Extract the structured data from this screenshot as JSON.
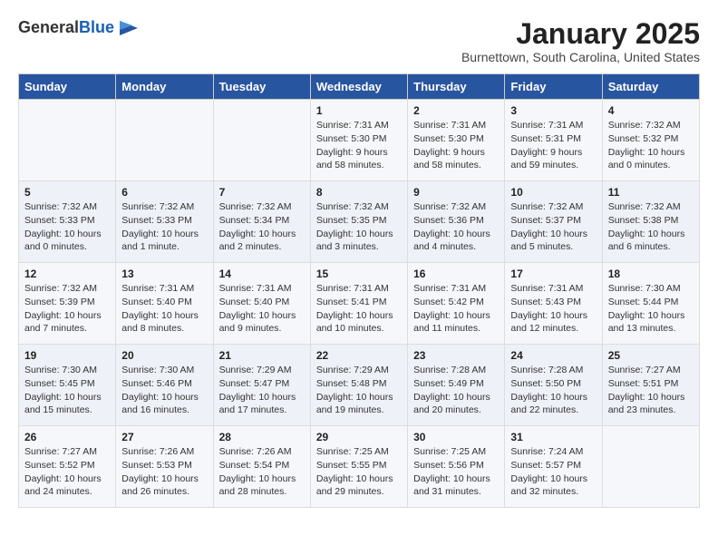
{
  "header": {
    "logo_general": "General",
    "logo_blue": "Blue",
    "month_title": "January 2025",
    "location": "Burnettown, South Carolina, United States"
  },
  "days_of_week": [
    "Sunday",
    "Monday",
    "Tuesday",
    "Wednesday",
    "Thursday",
    "Friday",
    "Saturday"
  ],
  "weeks": [
    [
      {
        "day": "",
        "info": ""
      },
      {
        "day": "",
        "info": ""
      },
      {
        "day": "",
        "info": ""
      },
      {
        "day": "1",
        "info": "Sunrise: 7:31 AM\nSunset: 5:30 PM\nDaylight: 9 hours\nand 58 minutes."
      },
      {
        "day": "2",
        "info": "Sunrise: 7:31 AM\nSunset: 5:30 PM\nDaylight: 9 hours\nand 58 minutes."
      },
      {
        "day": "3",
        "info": "Sunrise: 7:31 AM\nSunset: 5:31 PM\nDaylight: 9 hours\nand 59 minutes."
      },
      {
        "day": "4",
        "info": "Sunrise: 7:32 AM\nSunset: 5:32 PM\nDaylight: 10 hours\nand 0 minutes."
      }
    ],
    [
      {
        "day": "5",
        "info": "Sunrise: 7:32 AM\nSunset: 5:33 PM\nDaylight: 10 hours\nand 0 minutes."
      },
      {
        "day": "6",
        "info": "Sunrise: 7:32 AM\nSunset: 5:33 PM\nDaylight: 10 hours\nand 1 minute."
      },
      {
        "day": "7",
        "info": "Sunrise: 7:32 AM\nSunset: 5:34 PM\nDaylight: 10 hours\nand 2 minutes."
      },
      {
        "day": "8",
        "info": "Sunrise: 7:32 AM\nSunset: 5:35 PM\nDaylight: 10 hours\nand 3 minutes."
      },
      {
        "day": "9",
        "info": "Sunrise: 7:32 AM\nSunset: 5:36 PM\nDaylight: 10 hours\nand 4 minutes."
      },
      {
        "day": "10",
        "info": "Sunrise: 7:32 AM\nSunset: 5:37 PM\nDaylight: 10 hours\nand 5 minutes."
      },
      {
        "day": "11",
        "info": "Sunrise: 7:32 AM\nSunset: 5:38 PM\nDaylight: 10 hours\nand 6 minutes."
      }
    ],
    [
      {
        "day": "12",
        "info": "Sunrise: 7:32 AM\nSunset: 5:39 PM\nDaylight: 10 hours\nand 7 minutes."
      },
      {
        "day": "13",
        "info": "Sunrise: 7:31 AM\nSunset: 5:40 PM\nDaylight: 10 hours\nand 8 minutes."
      },
      {
        "day": "14",
        "info": "Sunrise: 7:31 AM\nSunset: 5:40 PM\nDaylight: 10 hours\nand 9 minutes."
      },
      {
        "day": "15",
        "info": "Sunrise: 7:31 AM\nSunset: 5:41 PM\nDaylight: 10 hours\nand 10 minutes."
      },
      {
        "day": "16",
        "info": "Sunrise: 7:31 AM\nSunset: 5:42 PM\nDaylight: 10 hours\nand 11 minutes."
      },
      {
        "day": "17",
        "info": "Sunrise: 7:31 AM\nSunset: 5:43 PM\nDaylight: 10 hours\nand 12 minutes."
      },
      {
        "day": "18",
        "info": "Sunrise: 7:30 AM\nSunset: 5:44 PM\nDaylight: 10 hours\nand 13 minutes."
      }
    ],
    [
      {
        "day": "19",
        "info": "Sunrise: 7:30 AM\nSunset: 5:45 PM\nDaylight: 10 hours\nand 15 minutes."
      },
      {
        "day": "20",
        "info": "Sunrise: 7:30 AM\nSunset: 5:46 PM\nDaylight: 10 hours\nand 16 minutes."
      },
      {
        "day": "21",
        "info": "Sunrise: 7:29 AM\nSunset: 5:47 PM\nDaylight: 10 hours\nand 17 minutes."
      },
      {
        "day": "22",
        "info": "Sunrise: 7:29 AM\nSunset: 5:48 PM\nDaylight: 10 hours\nand 19 minutes."
      },
      {
        "day": "23",
        "info": "Sunrise: 7:28 AM\nSunset: 5:49 PM\nDaylight: 10 hours\nand 20 minutes."
      },
      {
        "day": "24",
        "info": "Sunrise: 7:28 AM\nSunset: 5:50 PM\nDaylight: 10 hours\nand 22 minutes."
      },
      {
        "day": "25",
        "info": "Sunrise: 7:27 AM\nSunset: 5:51 PM\nDaylight: 10 hours\nand 23 minutes."
      }
    ],
    [
      {
        "day": "26",
        "info": "Sunrise: 7:27 AM\nSunset: 5:52 PM\nDaylight: 10 hours\nand 24 minutes."
      },
      {
        "day": "27",
        "info": "Sunrise: 7:26 AM\nSunset: 5:53 PM\nDaylight: 10 hours\nand 26 minutes."
      },
      {
        "day": "28",
        "info": "Sunrise: 7:26 AM\nSunset: 5:54 PM\nDaylight: 10 hours\nand 28 minutes."
      },
      {
        "day": "29",
        "info": "Sunrise: 7:25 AM\nSunset: 5:55 PM\nDaylight: 10 hours\nand 29 minutes."
      },
      {
        "day": "30",
        "info": "Sunrise: 7:25 AM\nSunset: 5:56 PM\nDaylight: 10 hours\nand 31 minutes."
      },
      {
        "day": "31",
        "info": "Sunrise: 7:24 AM\nSunset: 5:57 PM\nDaylight: 10 hours\nand 32 minutes."
      },
      {
        "day": "",
        "info": ""
      }
    ]
  ]
}
